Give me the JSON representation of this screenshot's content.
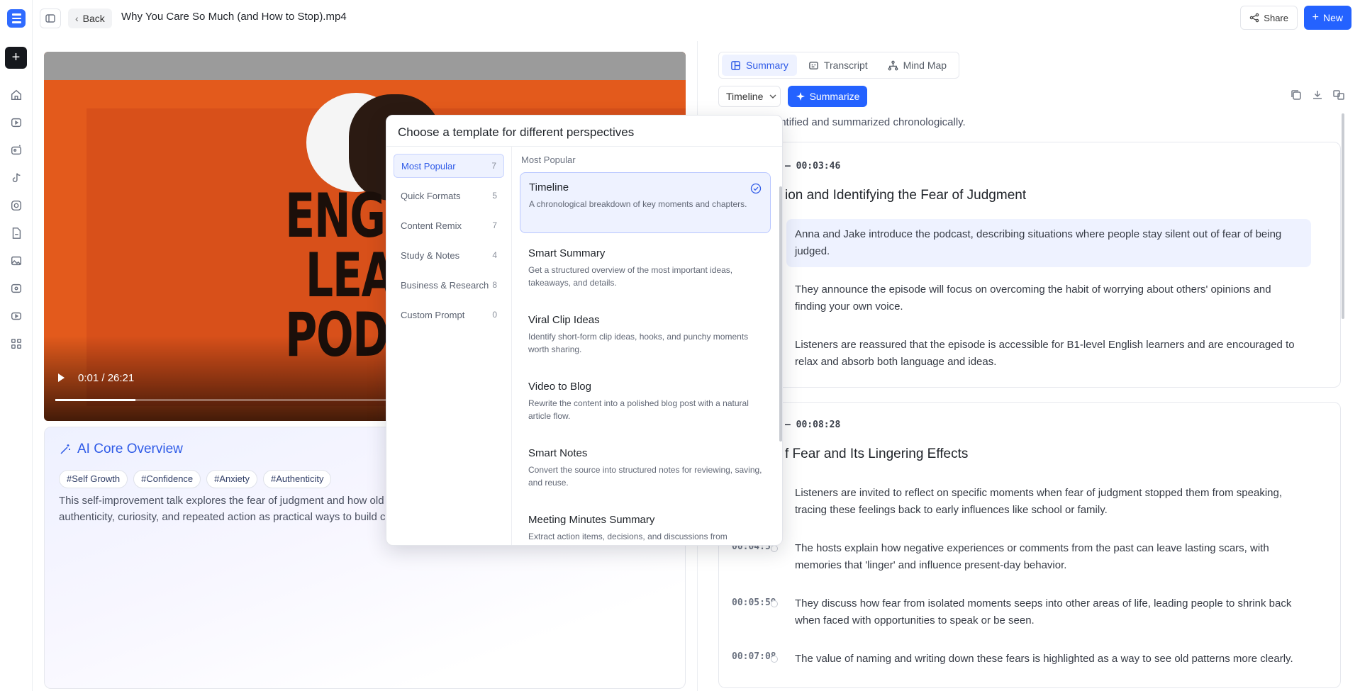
{
  "topbar": {
    "back_label": "Back",
    "file_title": "Why You Care So Much (and How to Stop).mp4",
    "share_label": "Share",
    "new_label": "New"
  },
  "video": {
    "time": "0:01 / 26:21",
    "progress_fraction": 0.13,
    "poster_text": [
      "ENGLI",
      "LEA",
      "PODC"
    ]
  },
  "overview": {
    "title": "AI Core Overview",
    "tags": [
      "#Self Growth",
      "#Confidence",
      "#Anxiety",
      "#Authenticity"
    ],
    "text_line1": "This self-improvement talk explores the fear of judgment and how old",
    "text_line2": "authenticity, curiosity, and repeated action as practical ways to build c"
  },
  "panel": {
    "tabs": [
      {
        "label": "Summary",
        "icon": "summary-icon"
      },
      {
        "label": "Transcript",
        "icon": "transcript-icon"
      },
      {
        "label": "Mind Map",
        "icon": "mindmap-icon"
      }
    ],
    "template_select": "Timeline",
    "summarize_label": "Summarize",
    "intro": "nts identified and summarized chronologically.",
    "sections": [
      {
        "time": "– 00:03:46",
        "title": "ion and Identifying the Fear of Judgment",
        "items": [
          {
            "text": "Anna and Jake introduce the podcast, describing situations where people stay silent out of fear of being judged."
          },
          {
            "text": "They announce the episode will focus on overcoming the habit of worrying about others' opinions and finding your own voice."
          },
          {
            "text": "Listeners are reassured that the episode is accessible for B1-level English learners and are encouraged to relax and absorb both language and ideas."
          }
        ]
      },
      {
        "time": "– 00:08:28",
        "title": "f Fear and Its Lingering Effects",
        "items": [
          {
            "ts": "",
            "text": "Listeners are invited to reflect on specific moments when fear of judgment stopped them from speaking, tracing these feelings back to early influences like school or family."
          },
          {
            "ts": "00:04:53",
            "text": "The hosts explain how negative experiences or comments from the past can leave lasting scars, with memories that 'linger' and influence present-day behavior."
          },
          {
            "ts": "00:05:59",
            "text": "They discuss how fear from isolated moments seeps into other areas of life, leading people to shrink back when faced with opportunities to speak or be seen."
          },
          {
            "ts": "00:07:08",
            "text": "The value of naming and writing down these fears is highlighted as a way to see old patterns more clearly."
          }
        ]
      }
    ]
  },
  "popup": {
    "title": "Choose a template for different perspectives",
    "categories": [
      {
        "label": "Most Popular",
        "count": "7"
      },
      {
        "label": "Quick Formats",
        "count": "5"
      },
      {
        "label": "Content Remix",
        "count": "7"
      },
      {
        "label": "Study & Notes",
        "count": "4"
      },
      {
        "label": "Business & Research",
        "count": "8"
      },
      {
        "label": "Custom Prompt",
        "count": "0"
      }
    ],
    "list_heading": "Most Popular",
    "templates": [
      {
        "name": "Timeline",
        "desc": "A chronological breakdown of key moments and chapters."
      },
      {
        "name": "Smart Summary",
        "desc": "Get a structured overview of the most important ideas, takeaways, and details."
      },
      {
        "name": "Viral Clip Ideas",
        "desc": "Identify short-form clip ideas, hooks, and punchy moments worth sharing."
      },
      {
        "name": "Video to Blog",
        "desc": "Rewrite the content into a polished blog post with a natural article flow."
      },
      {
        "name": "Smart Notes",
        "desc": "Convert the source into structured notes for reviewing, saving, and reuse."
      },
      {
        "name": "Meeting Minutes Summary",
        "desc": "Extract action items, decisions, and discussions from"
      }
    ]
  },
  "colors": {
    "accent": "#2462ff",
    "video_bg": "#e35a1c"
  }
}
